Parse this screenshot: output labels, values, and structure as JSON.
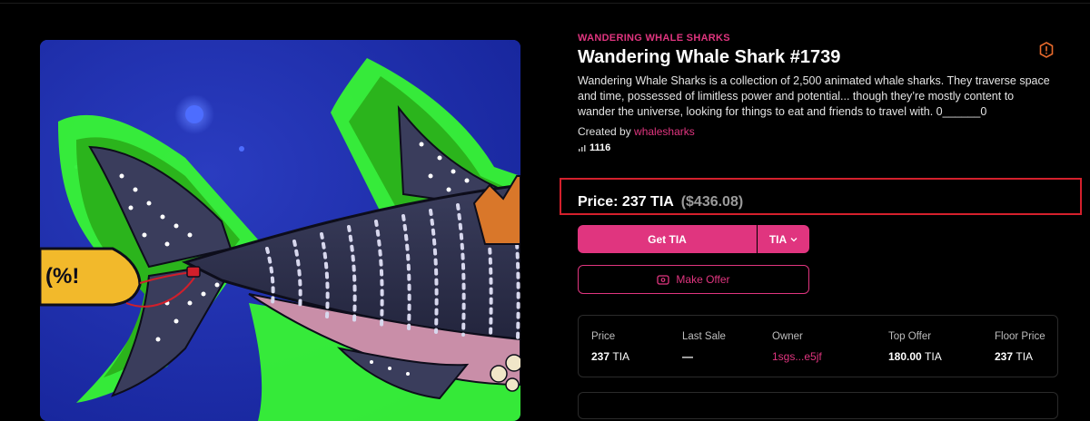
{
  "collection": "WANDERING WHALE SHARKS",
  "title": "Wandering Whale Shark #1739",
  "description": "Wandering Whale Sharks is a collection of 2,500 animated whale sharks. They traverse space and time, possessed of limitless power and potential... though they’re mostly content to wander the universe, looking for things to eat and friends to travel with. 0______0",
  "creator": {
    "prefix": "Created by",
    "name": "whalesharks"
  },
  "views": "1116",
  "price": {
    "label": "Price: 237 TIA",
    "usd": "($436.08)"
  },
  "buttons": {
    "get": "Get TIA",
    "currency": "TIA",
    "offer": "Make Offer"
  },
  "stats": {
    "price": {
      "label": "Price",
      "value": "237",
      "unit": "TIA"
    },
    "last_sale": {
      "label": "Last Sale",
      "value": "—"
    },
    "owner": {
      "label": "Owner",
      "value": "1sgs...e5jf"
    },
    "top_offer": {
      "label": "Top Offer",
      "value": "180.00",
      "unit": "TIA"
    },
    "floor_price": {
      "label": "Floor Price",
      "value": "237",
      "unit": "TIA"
    }
  },
  "artwork": {
    "sign_text": "(%!"
  },
  "colors": {
    "accent": "#e0357f",
    "highlight_box": "#d4202c",
    "background": "#000000"
  },
  "icons": [
    "report-icon",
    "views-chart-icon",
    "chevron-down-icon",
    "offer-icon"
  ]
}
